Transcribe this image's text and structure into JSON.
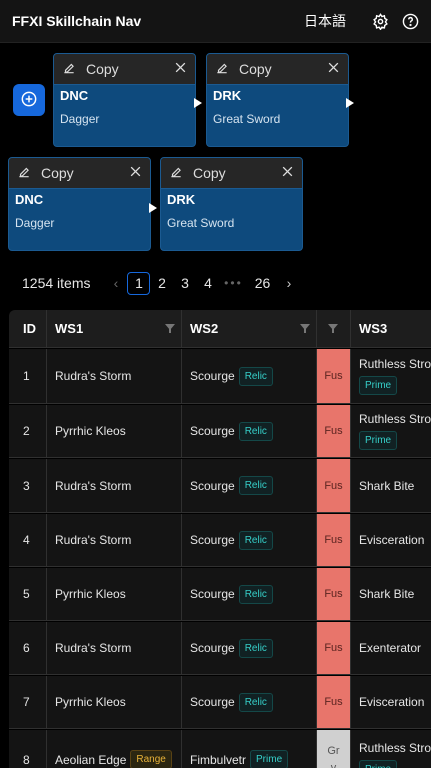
{
  "header": {
    "title": "FFXI Skillchain Nav",
    "language": "日本語"
  },
  "cards": [
    {
      "copy_label": "Copy",
      "job": "DNC",
      "weapon": "Dagger"
    },
    {
      "copy_label": "Copy",
      "job": "DRK",
      "weapon": "Great Sword"
    },
    {
      "copy_label": "Copy",
      "job": "DNC",
      "weapon": "Dagger"
    },
    {
      "copy_label": "Copy",
      "job": "DRK",
      "weapon": "Great Sword"
    }
  ],
  "pagination": {
    "total": "1254 items",
    "pages": [
      "1",
      "2",
      "3",
      "4",
      "26"
    ],
    "current": "1",
    "ellipsis": "•••"
  },
  "table": {
    "columns": [
      "ID",
      "WS1",
      "WS2",
      "",
      "WS3"
    ],
    "rows": [
      {
        "id": "1",
        "ws1": "Rudra's Storm",
        "ws1_tag": "",
        "ws2": "Scourge",
        "ws2_tag": "Relic",
        "el": "Fus",
        "ws3": "Ruthless Stroke",
        "ws3_tag": "Prime"
      },
      {
        "id": "2",
        "ws1": "Pyrrhic Kleos",
        "ws1_tag": "",
        "ws2": "Scourge",
        "ws2_tag": "Relic",
        "el": "Fus",
        "ws3": "Ruthless Stroke",
        "ws3_tag": "Prime"
      },
      {
        "id": "3",
        "ws1": "Rudra's Storm",
        "ws1_tag": "",
        "ws2": "Scourge",
        "ws2_tag": "Relic",
        "el": "Fus",
        "ws3": "Shark Bite",
        "ws3_tag": ""
      },
      {
        "id": "4",
        "ws1": "Rudra's Storm",
        "ws1_tag": "",
        "ws2": "Scourge",
        "ws2_tag": "Relic",
        "el": "Fus",
        "ws3": "Evisceration",
        "ws3_tag": ""
      },
      {
        "id": "5",
        "ws1": "Pyrrhic Kleos",
        "ws1_tag": "",
        "ws2": "Scourge",
        "ws2_tag": "Relic",
        "el": "Fus",
        "ws3": "Shark Bite",
        "ws3_tag": ""
      },
      {
        "id": "6",
        "ws1": "Rudra's Storm",
        "ws1_tag": "",
        "ws2": "Scourge",
        "ws2_tag": "Relic",
        "el": "Fus",
        "ws3": "Exenterator",
        "ws3_tag": ""
      },
      {
        "id": "7",
        "ws1": "Pyrrhic Kleos",
        "ws1_tag": "",
        "ws2": "Scourge",
        "ws2_tag": "Relic",
        "el": "Fus",
        "ws3": "Evisceration",
        "ws3_tag": ""
      },
      {
        "id": "8",
        "ws1": "Aeolian Edge",
        "ws1_tag": "Range",
        "ws2": "Fimbulvetr",
        "ws2_tag": "Prime",
        "el": "Grv",
        "ws3": "Ruthless Stroke",
        "ws3_tag": "Prime"
      }
    ]
  },
  "colors": {
    "accent": "#1668dc",
    "card": "#0e4a7d",
    "fusion": "#e8756b",
    "gravitation": "#d0d0d0"
  },
  "icons": [
    "settings-icon",
    "help-icon",
    "plus-circle-icon",
    "edit-icon",
    "close-icon",
    "filter-icon"
  ]
}
